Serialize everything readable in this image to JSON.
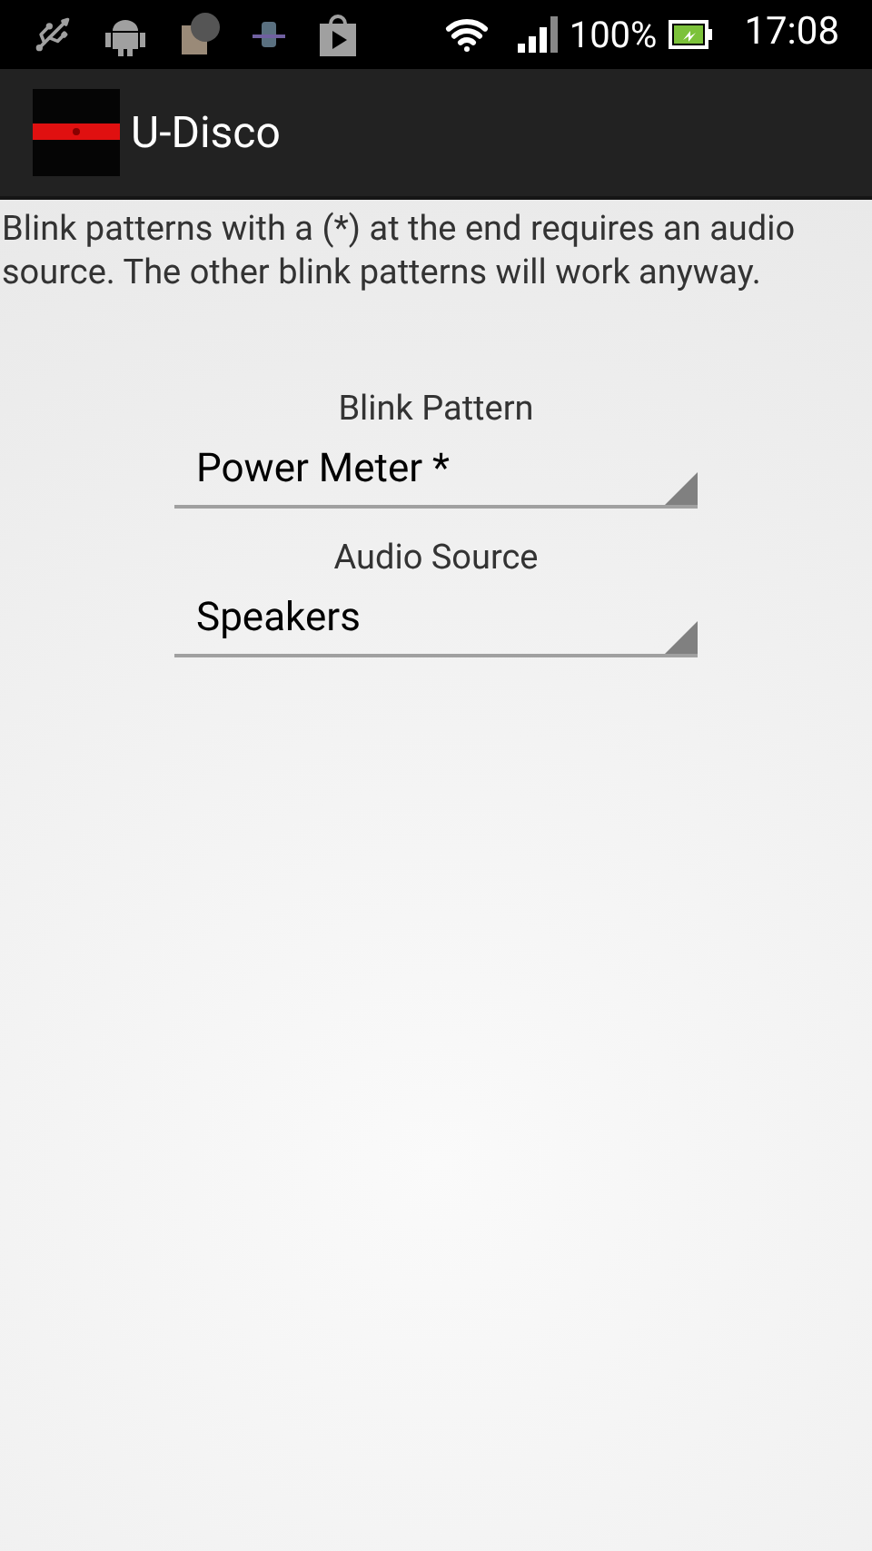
{
  "status_bar": {
    "battery": "100%",
    "time": "17:08"
  },
  "action_bar": {
    "title": "U-Disco"
  },
  "intro": "Blink patterns with a (*) at the end requires an audio source. The other blink patterns will work anyway.",
  "spinners": [
    {
      "label": "Blink Pattern",
      "value": "Power Meter *"
    },
    {
      "label": "Audio Source",
      "value": "Speakers"
    }
  ]
}
